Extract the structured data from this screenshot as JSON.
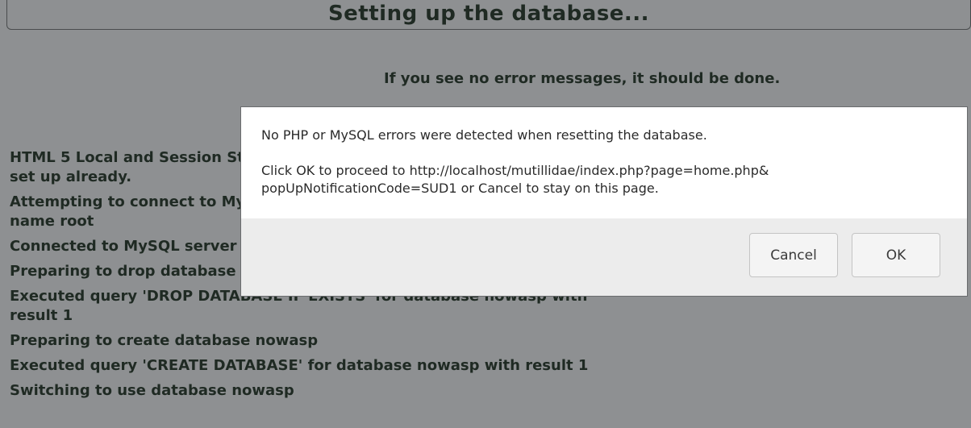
{
  "page": {
    "title": "Setting up the database...",
    "subtitle": "If you see no error messages, it should be done."
  },
  "log": [
    "HTML 5 Local and Session Storage cleared unless HTML5 Storage is not set up already.",
    "Attempting to connect to MySQL server on host 127.0.0.1 with user name root",
    "Connected to MySQL server at 127.0.0.1 as root",
    "Preparing to drop database nowasp",
    "Executed query 'DROP DATABASE IF EXISTS' for database nowasp with result 1",
    "Preparing to create database nowasp",
    "Executed query 'CREATE DATABASE' for database nowasp with result 1",
    "Switching to use database nowasp"
  ],
  "dialog": {
    "message": "No PHP or MySQL errors were detected when resetting the database.\n\nClick OK to proceed to http://localhost/mutillidae/index.php?page=home.php&\npopUpNotificationCode=SUD1 or Cancel to stay on this page.",
    "cancel_label": "Cancel",
    "ok_label": "OK"
  }
}
